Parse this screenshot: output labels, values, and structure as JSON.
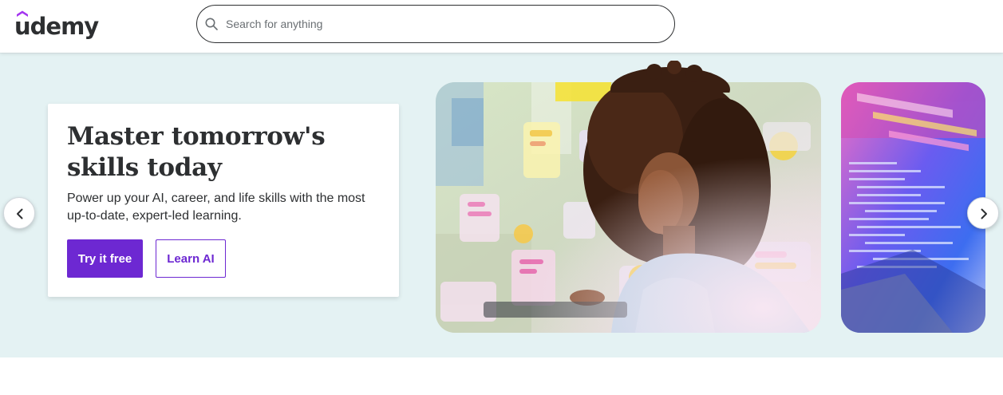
{
  "header": {
    "logo_text": "udemy",
    "search": {
      "placeholder": "Search for anything",
      "value": ""
    }
  },
  "hero": {
    "title": "Master tomorrow's skills today",
    "subtitle": "Power up your AI, career, and life skills with the most up-to-date, expert-led learning.",
    "primary_cta": "Try it free",
    "secondary_cta": "Learn AI"
  },
  "colors": {
    "brand_purple": "#6d28d2",
    "hero_background": "#e4f2f3",
    "text_dark": "#2d2f31"
  },
  "icons": [
    "search-icon",
    "chevron-left-icon",
    "chevron-right-icon"
  ]
}
